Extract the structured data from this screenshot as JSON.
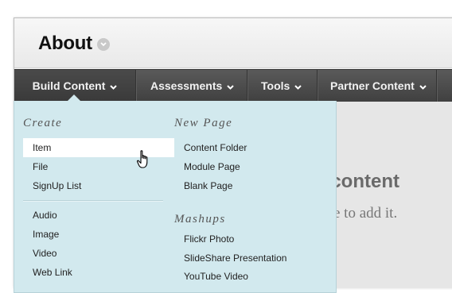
{
  "page": {
    "title": "About"
  },
  "menubar": {
    "items": [
      {
        "label": "Build Content"
      },
      {
        "label": "Assessments"
      },
      {
        "label": "Tools"
      },
      {
        "label": "Partner Content"
      }
    ]
  },
  "dropdown": {
    "create": {
      "title": "Create",
      "items": [
        "Item",
        "File",
        "SignUp List"
      ],
      "media_items": [
        "Audio",
        "Image",
        "Video",
        "Web Link"
      ]
    },
    "new_page": {
      "title": "New Page",
      "items": [
        "Content Folder",
        "Module Page",
        "Blank Page"
      ]
    },
    "mashups": {
      "title": "Mashups",
      "items": [
        "Flickr Photo",
        "SlideShare Presentation",
        "YouTube Video"
      ]
    }
  },
  "background": {
    "heading_fragment": "d content",
    "sub_fragment": "ove to add it."
  },
  "colors": {
    "menubar": "#474747",
    "dropdown": "#d2e9ee",
    "highlight": "#ffffff"
  },
  "icons": {
    "title_chevron": "chevron-down-icon",
    "cursor": "hand-pointer-icon"
  }
}
